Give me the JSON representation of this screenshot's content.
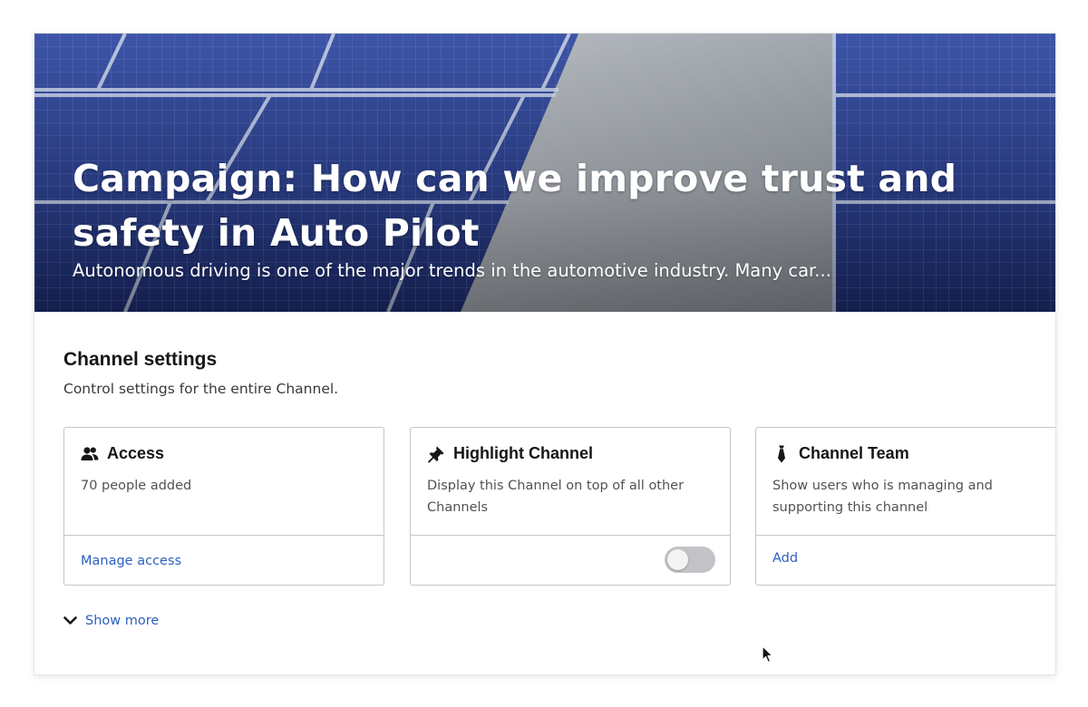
{
  "hero": {
    "title": "Campaign: How can we improve trust and safety in Auto Pilot",
    "description": "Autonomous driving is one of the major trends in the automotive industry. Many car..."
  },
  "settings": {
    "title": "Channel settings",
    "subtitle": "Control settings for the entire Channel.",
    "cards": [
      {
        "icon": "people-icon",
        "title": "Access",
        "description": "70 people added",
        "action": "Manage access"
      },
      {
        "icon": "pin-icon",
        "title": "Highlight Channel",
        "description": "Display this Channel on top of all other Channels",
        "toggle_on": false
      },
      {
        "icon": "tie-icon",
        "title": "Channel Team",
        "description": "Show users who is managing and supporting this channel",
        "action": "Add"
      }
    ],
    "show_more": "Show more"
  },
  "colors": {
    "link": "#2d5fbf",
    "toggle_off": "#c3c3c7",
    "border": "#c6c6c6"
  }
}
